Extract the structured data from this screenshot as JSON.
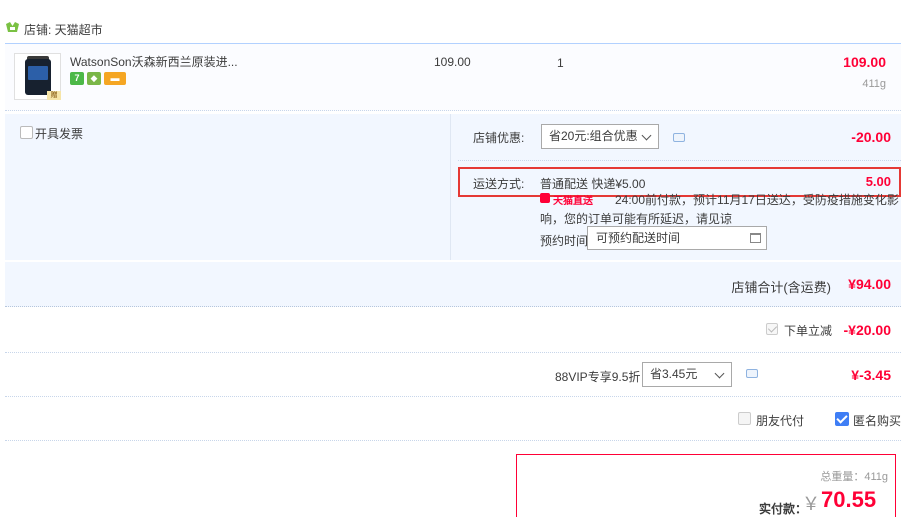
{
  "shop": {
    "label": "店铺: 天猫超市",
    "icon": "tmall-shop-icon"
  },
  "item": {
    "title": "WatsonSon沃森新西兰原装进...",
    "unit_price": "109.00",
    "quantity": "1",
    "subtotal": "109.00",
    "weight": "411g",
    "thumb_badge": "赠",
    "badges": [
      {
        "name": "seven-day-return-badge",
        "text": "7",
        "color": "#4cb848"
      },
      {
        "name": "guarantee-badge",
        "text": "◆",
        "color": "#7ab648"
      },
      {
        "name": "credit-card-badge",
        "text": "▬",
        "color": "#f5a623"
      }
    ]
  },
  "invoice": {
    "label": "开具发票"
  },
  "shop_discount": {
    "label": "店铺优惠:",
    "selected": "省20元:组合优惠",
    "amount": "-20.00"
  },
  "delivery": {
    "label": "运送方式:",
    "value": "普通配送 快递¥5.00",
    "amount": "5.00",
    "tmall_tag": "天猫直送",
    "notice_line1": "24:00前付款，预计11月17日送达，受防疫措施变化影",
    "notice_line2": "响，您的订单可能有所延迟，请见谅",
    "booking_label": "预约时间",
    "booking_value": "可预约配送时间"
  },
  "shop_total": {
    "label": "店铺合计(含运费)",
    "amount": "¥94.00"
  },
  "instant_discount": {
    "label": "下单立减",
    "amount": "-¥20.00"
  },
  "vip": {
    "label": "88VIP专享9.5折",
    "selected": "省3.45元",
    "amount": "¥-3.45"
  },
  "options": {
    "friend_pay": "朋友代付",
    "anonymous": "匿名购买"
  },
  "payment": {
    "total_weight": "总重量：411g",
    "label": "实付款：",
    "currency": "￥",
    "amount": "70.55"
  },
  "colors": {
    "accent": "#ff0036",
    "highlight_box": "#e53935",
    "panel": "#f2f7ff",
    "checkbox_blue": "#3f7ef5"
  }
}
